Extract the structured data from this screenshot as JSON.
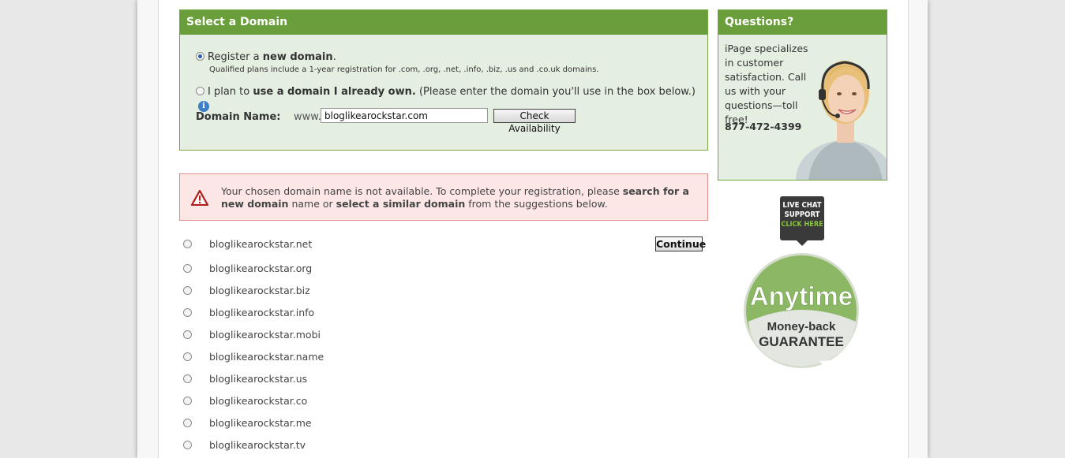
{
  "select_domain": {
    "title": "Select a Domain",
    "option_new_prefix": "Register a ",
    "option_new_bold": "new domain",
    "option_new_suffix": ".",
    "option_new_note": "Qualified plans include a 1-year registration for .com, .org, .net, .info, .biz, .us and .co.uk domains.",
    "option_own_prefix": "I plan to ",
    "option_own_bold": "use a domain I already own.",
    "option_own_suffix": " (Please enter the domain you'll use in the box below.)",
    "info_icon_glyph": "i",
    "domain_label": "Domain Name:",
    "www_prefix": "www.",
    "domain_value": "bloglikearockstar.com",
    "check_button": "Check Availability"
  },
  "alert": {
    "text_1": "Your chosen domain name is not available. To complete your registration, please ",
    "bold_1": "search for a new domain",
    "text_2": " name or ",
    "bold_2": "select a similar domain",
    "text_3": " from the suggestions below."
  },
  "suggestions": [
    "bloglikearockstar.net",
    "bloglikearockstar.org",
    "bloglikearockstar.biz",
    "bloglikearockstar.info",
    "bloglikearockstar.mobi",
    "bloglikearockstar.name",
    "bloglikearockstar.us",
    "bloglikearockstar.co",
    "bloglikearockstar.me",
    "bloglikearockstar.tv"
  ],
  "continue_button": "Continue",
  "questions": {
    "title": "Questions?",
    "body": "iPage specializes in customer satisfaction. Call us with your questions—toll free!",
    "phone": "877-472-4399"
  },
  "chat": {
    "line1": "LIVE CHAT",
    "line2": "SUPPORT",
    "line3": "CLICK HERE"
  },
  "guarantee": {
    "line1": "Anytime",
    "line2": "Money-back",
    "line3": "GUARANTEE"
  },
  "colors": {
    "header_green": "#6a9e3a",
    "panel_bg": "#e4eee1",
    "alert_bg": "#fde7e6",
    "alert_border": "#e38c8c"
  }
}
